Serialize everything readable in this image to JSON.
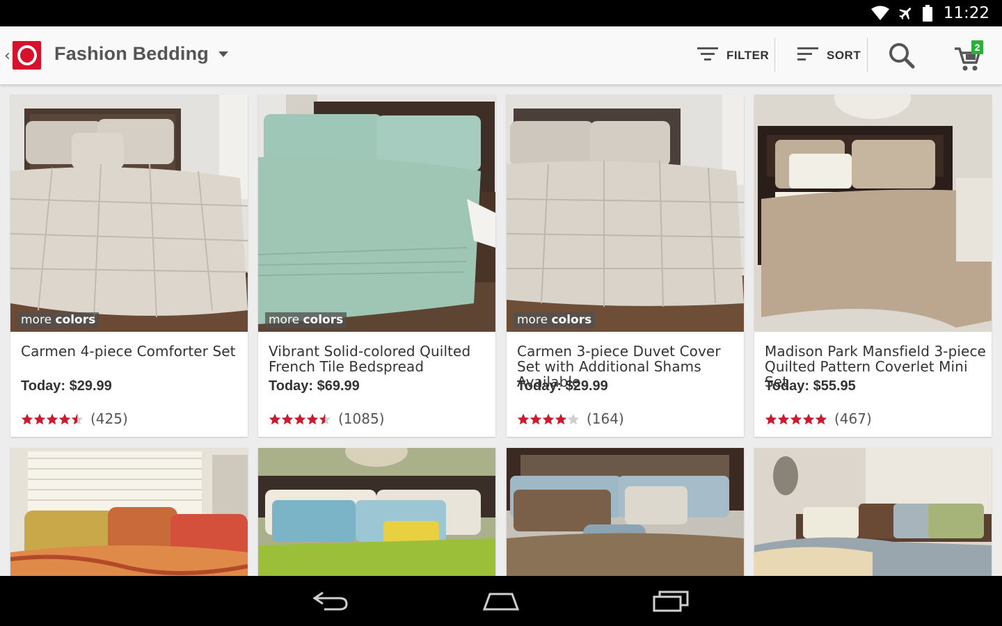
{
  "status_bar": {
    "time": "11:22",
    "icons": [
      "wifi-icon",
      "airplane-mode-icon",
      "battery-icon"
    ]
  },
  "app_bar": {
    "title": "Fashion Bedding",
    "filter_label": "FILTER",
    "sort_label": "SORT",
    "cart_count": "2",
    "brand_color": "#d7102b",
    "badge_color": "#2cae3a"
  },
  "products": [
    {
      "name": "Carmen 4-piece Comforter Set",
      "price": "Today: $29.99",
      "rating": 4.5,
      "review_count": "(425)",
      "more_colors": true,
      "more_colors_label": [
        "more ",
        "colors"
      ]
    },
    {
      "name": "Vibrant Solid-colored Quilted French Tile Bedspread",
      "price": "Today: $69.99",
      "rating": 4.5,
      "review_count": "(1085)",
      "more_colors": true,
      "more_colors_label": [
        "more ",
        "colors"
      ]
    },
    {
      "name": "Carmen 3-piece Duvet Cover Set with Additional Shams Available",
      "price": "Today: $29.99",
      "rating": 4,
      "review_count": "(164)",
      "more_colors": true,
      "more_colors_label": [
        "more ",
        "colors"
      ]
    },
    {
      "name": "Madison Park Mansfield 3-piece Quilted Pattern Coverlet Mini Set",
      "price": "Today: $55.95",
      "rating": 5,
      "review_count": "(467)",
      "more_colors": false
    }
  ],
  "star_color": "#cc1a2e",
  "nav_bar": {
    "buttons": [
      "back-nav-icon",
      "home-nav-icon",
      "recent-apps-icon"
    ]
  }
}
